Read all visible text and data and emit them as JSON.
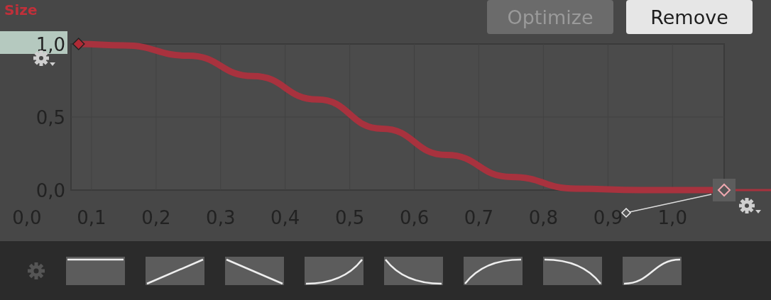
{
  "buttons": [
    {
      "label": "Optimize",
      "disabled": true
    },
    {
      "label": "Remove",
      "disabled": false
    }
  ],
  "curve": {
    "chart_data": {
      "type": "line",
      "x": [
        0.08,
        0.15,
        0.25,
        0.35,
        0.45,
        0.55,
        0.65,
        0.75,
        0.85,
        0.95,
        1.08
      ],
      "series": [
        {
          "name": "Size",
          "color": "#a8323e",
          "values": [
            1.0,
            0.99,
            0.92,
            0.78,
            0.62,
            0.42,
            0.24,
            0.09,
            0.01,
            0.0,
            0.0
          ]
        }
      ],
      "xlim": [
        0,
        1.08
      ],
      "grid": true,
      "ylim": [
        0,
        1.0
      ],
      "xticks": [
        {
          "value": 0,
          "label": "0,0"
        },
        {
          "value": 0.1,
          "label": "0,1"
        },
        {
          "value": 0.2,
          "label": "0,2"
        },
        {
          "value": 0.3,
          "label": "0,3"
        },
        {
          "value": 0.4,
          "label": "0,4"
        },
        {
          "value": 0.5,
          "label": "0,5"
        },
        {
          "value": 0.6,
          "label": "0,6"
        },
        {
          "value": 0.7,
          "label": "0,7"
        },
        {
          "value": 0.8,
          "label": "0,8"
        },
        {
          "value": 0.9,
          "label": "0,9"
        },
        {
          "value": 1.0,
          "label": "1,0"
        }
      ],
      "yticks": [
        {
          "value": 0,
          "label": "0,0"
        },
        {
          "value": 0.5,
          "label": "0,5"
        },
        {
          "value": 1.0,
          "label": "1,0"
        }
      ]
    }
  },
  "presets": [
    {
      "kind": "constant"
    },
    {
      "kind": "linear-up"
    },
    {
      "kind": "linear-down"
    },
    {
      "kind": "ease-in"
    },
    {
      "kind": "ease-out-down"
    },
    {
      "kind": "ease-out"
    },
    {
      "kind": "ease-in-down"
    },
    {
      "kind": "s-curve"
    }
  ]
}
